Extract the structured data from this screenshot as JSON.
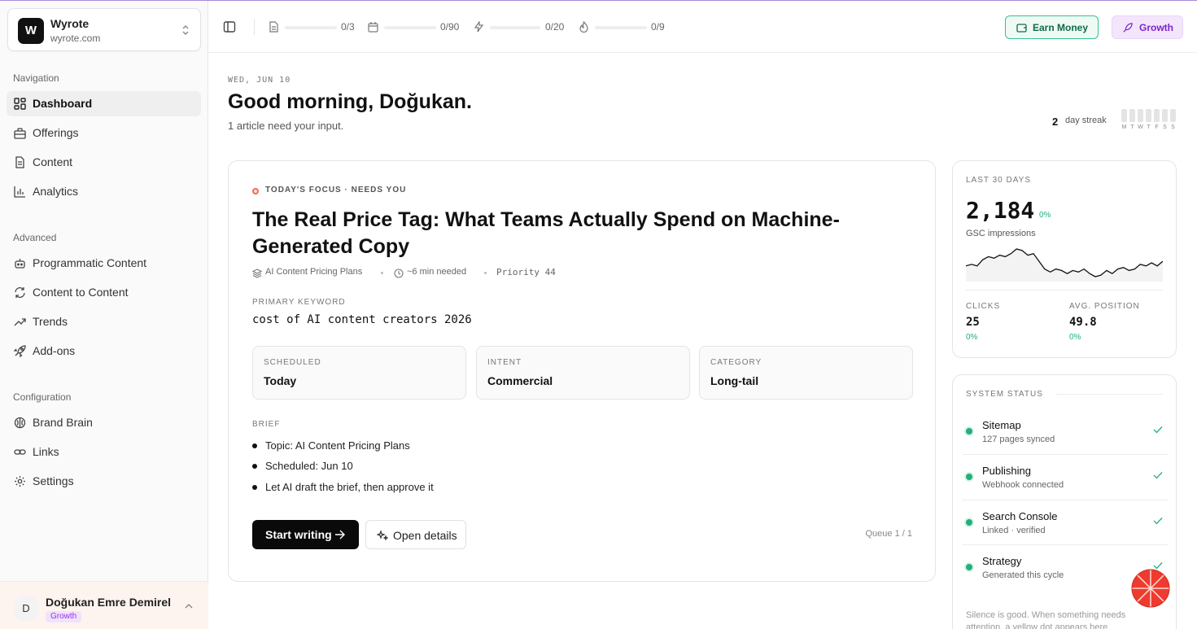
{
  "workspace": {
    "logo_letter": "W",
    "name": "Wyrote",
    "domain": "wyrote.com"
  },
  "nav": {
    "groups": [
      {
        "label": "Navigation",
        "items": [
          {
            "label": "Dashboard",
            "icon": "dashboard-icon",
            "active": true
          },
          {
            "label": "Offerings",
            "icon": "offerings-icon"
          },
          {
            "label": "Content",
            "icon": "document-icon"
          },
          {
            "label": "Analytics",
            "icon": "bar-chart-icon"
          }
        ]
      },
      {
        "label": "Advanced",
        "items": [
          {
            "label": "Programmatic Content",
            "icon": "robot-icon"
          },
          {
            "label": "Content to Content",
            "icon": "refresh-icon"
          },
          {
            "label": "Trends",
            "icon": "trending-up-icon"
          },
          {
            "label": "Add-ons",
            "icon": "rocket-icon"
          }
        ]
      },
      {
        "label": "Configuration",
        "items": [
          {
            "label": "Brand Brain",
            "icon": "brain-icon"
          },
          {
            "label": "Links",
            "icon": "link-icon"
          },
          {
            "label": "Settings",
            "icon": "gear-icon"
          }
        ]
      }
    ]
  },
  "user": {
    "initial": "D",
    "name": "Doğukan Emre Demirel",
    "plan": "Growth"
  },
  "topbar": {
    "meters": [
      {
        "icon": "document-icon",
        "value": "0/3",
        "fill": 0
      },
      {
        "icon": "calendar-icon",
        "value": "0/90",
        "fill": 0
      },
      {
        "icon": "lightning-icon",
        "value": "0/20",
        "fill": 0
      },
      {
        "icon": "flame-icon",
        "value": "0/9",
        "fill": 0
      }
    ],
    "earn_label": "Earn Money",
    "growth_label": "Growth"
  },
  "header": {
    "date": "WED, JUN 10",
    "greeting": "Good morning, Doğukan.",
    "subline": "1 article need your input.",
    "streak_count": "2",
    "streak_label": "day streak",
    "streak_days": [
      "M",
      "T",
      "W",
      "T",
      "F",
      "S",
      "S"
    ]
  },
  "focus": {
    "eyebrow": "TODAY'S FOCUS · NEEDS YOU",
    "title": "The Real Price Tag: What Teams Actually Spend on Machine-Generated Copy",
    "topic": "AI Content Pricing Plans",
    "time_needed": "~6 min needed",
    "priority": "Priority 44",
    "keyword_label": "PRIMARY KEYWORD",
    "keyword": "cost of AI content creators 2026",
    "stats": [
      {
        "label": "SCHEDULED",
        "value": "Today"
      },
      {
        "label": "INTENT",
        "value": "Commercial"
      },
      {
        "label": "CATEGORY",
        "value": "Long-tail"
      }
    ],
    "brief_label": "BRIEF",
    "brief": [
      "Topic: AI Content Pricing Plans",
      "Scheduled: Jun 10",
      "Let AI draft the brief, then approve it"
    ],
    "start_label": "Start writing",
    "open_label": "Open details",
    "queue": "Queue 1 / 1"
  },
  "metrics": {
    "period": "LAST 30 DAYS",
    "impressions": "2,184",
    "impressions_delta": "0%",
    "impressions_label": "GSC impressions",
    "sparkline": [
      14,
      15,
      14,
      18,
      20,
      19,
      21,
      20,
      22,
      25,
      24,
      21,
      22,
      17,
      12,
      10,
      12,
      11,
      9,
      11,
      10,
      12,
      9,
      7,
      8,
      11,
      9,
      12,
      13,
      11,
      12,
      15,
      14,
      16,
      14,
      17
    ],
    "clicks_label": "CLICKS",
    "clicks": "25",
    "clicks_delta": "0%",
    "position_label": "AVG. POSITION",
    "position": "49.8",
    "position_delta": "0%"
  },
  "system": {
    "title": "SYSTEM STATUS",
    "items": [
      {
        "name": "Sitemap",
        "detail": "127 pages synced"
      },
      {
        "name": "Publishing",
        "detail": "Webhook connected"
      },
      {
        "name": "Search Console",
        "detail": "Linked · verified"
      },
      {
        "name": "Strategy",
        "detail": "Generated this cycle"
      }
    ],
    "footer": "Silence is good. When something needs attention, a yellow dot appears here."
  },
  "colors": {
    "accent_green": "#22b07a",
    "accent_purple": "#9333ea",
    "danger": "#f26b4f"
  }
}
